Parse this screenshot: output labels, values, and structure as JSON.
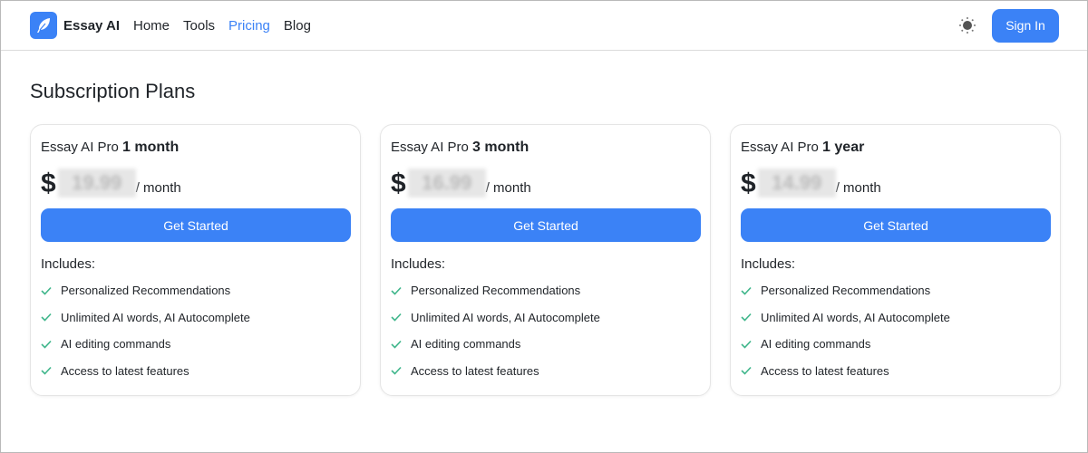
{
  "nav": {
    "brand": "Essay AI",
    "links": [
      {
        "label": "Home",
        "active": false
      },
      {
        "label": "Tools",
        "active": false
      },
      {
        "label": "Pricing",
        "active": true
      },
      {
        "label": "Blog",
        "active": false
      }
    ],
    "theme_icon": "sun-icon",
    "sign_in": "Sign In"
  },
  "page_title": "Subscription Plans",
  "plans": [
    {
      "prefix": "Essay AI Pro",
      "duration": "1 month",
      "currency": "$",
      "price": "19.99",
      "price_redacted": true,
      "per": "/ month",
      "cta": "Get Started"
    },
    {
      "prefix": "Essay AI Pro",
      "duration": "3 month",
      "currency": "$",
      "price": "16.99",
      "price_redacted": true,
      "per": "/ month",
      "cta": "Get Started"
    },
    {
      "prefix": "Essay AI Pro",
      "duration": "1 year",
      "currency": "$",
      "price": "14.99",
      "price_redacted": true,
      "per": "/ month",
      "cta": "Get Started"
    }
  ],
  "includes_label": "Includes:",
  "features": [
    "Personalized Recommendations",
    "Unlimited AI words, AI Autocomplete",
    "AI editing commands",
    "Access to latest features"
  ],
  "colors": {
    "accent": "#3b82f6",
    "check": "#3fb68b"
  }
}
